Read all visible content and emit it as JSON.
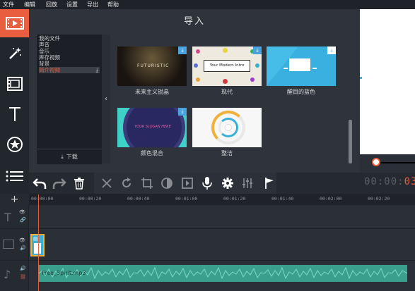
{
  "menu": [
    "文件",
    "编辑",
    "回放",
    "设置",
    "导出",
    "帮助"
  ],
  "sidebar_tools": [
    "import-tool",
    "effects-tool",
    "filters-tool",
    "titles-tool",
    "stickers-tool",
    "more-tool"
  ],
  "panel": {
    "title": "导入"
  },
  "file_list": {
    "items": [
      "我的文件",
      "声音",
      "音乐",
      "库存视频",
      "背景",
      "简介视频"
    ],
    "selected_index": 5,
    "download_label": "下载"
  },
  "thumbnails": [
    {
      "label": "未来主义锐晶",
      "inner_text": "FUTURISTIC"
    },
    {
      "label": "现代",
      "inner_text": "Your Modern Intro"
    },
    {
      "label": "醒目的蓝色",
      "inner_text": ""
    },
    {
      "label": "颜色混合",
      "inner_text": "YOUR SLOGAN HERE"
    },
    {
      "label": "整洁",
      "inner_text": ""
    }
  ],
  "toolbar": [
    "undo",
    "redo",
    "delete",
    "cut",
    "rotate",
    "crop",
    "color-adjust",
    "clip-properties",
    "voice-over",
    "settings",
    "equalizer",
    "marker"
  ],
  "timecode": {
    "dim": "00:00:",
    "highlight": "03"
  },
  "ruler_ticks": [
    "00:00:00",
    "00:00:20",
    "00:00:40",
    "00:01:00",
    "00:01:20",
    "00:01:40",
    "00:02:00",
    "00:02:20"
  ],
  "audio": {
    "clip_name": "Free_Spirit.mp3"
  },
  "colors": {
    "accent": "#e95e3e",
    "audio_wave": "#3aa08d",
    "download_badge": "#4aa3dc"
  }
}
